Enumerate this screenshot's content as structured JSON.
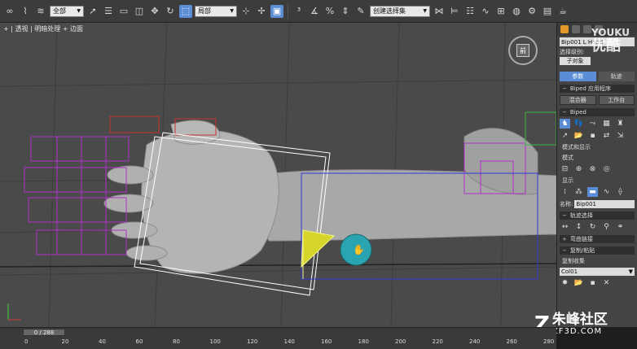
{
  "toolbar": {
    "selection_filter": "全部",
    "coord_system": "局部",
    "named_selection": "创建选择集",
    "icons": [
      "link-icon",
      "unlink-icon",
      "bind-icon",
      "select-icon",
      "select-by-name-icon",
      "rect-select-icon",
      "window-crossing-icon",
      "move-icon",
      "rotate-icon",
      "scale-icon",
      "pivot-icon",
      "snap-icon",
      "angle-snap-icon",
      "percent-snap-icon",
      "spinner-snap-icon",
      "mirror-icon",
      "align-icon",
      "layer-icon",
      "curve-editor-icon",
      "schematic-icon",
      "material-icon",
      "render-setup-icon",
      "render-frame-icon",
      "render-icon",
      "teapot-icon"
    ]
  },
  "viewport": {
    "label": "+ | 透视 | 明暗处理 + 边面"
  },
  "nav_cube_label": "前",
  "panel": {
    "object_name": "Bip001 L Hand",
    "selection_level_label": "选择级别:",
    "sub_object_button": "子对象",
    "motion_tabs": [
      "参数",
      "轨迹"
    ],
    "rollout_biped_apps": "Biped 应用程序",
    "btn_mixer": "混合器",
    "btn_workbench": "工作台",
    "rollout_biped": "Biped",
    "label_mode_display": "模式和显示",
    "label_mode": "模式",
    "label_display": "显示",
    "name_label": "名称:",
    "name_value": "Bip001",
    "rollout_track_select": "轨迹选择",
    "rollout_bend_links": "弯曲链接",
    "rollout_copy_paste": "复制/粘贴",
    "label_copy_collection": "复制收集",
    "collection_value": "Col01"
  },
  "watermarks": {
    "youku_line1": "YOUKU",
    "youku_line2": "优酷",
    "zf_text": "朱峰社区",
    "zf_url": "ZF3D.COM"
  },
  "timeline": {
    "time_slider_text": "0 / 288",
    "ruler_labels": [
      "0",
      "20",
      "40",
      "60",
      "80",
      "100",
      "120",
      "140",
      "160",
      "180",
      "200",
      "220",
      "240",
      "260",
      "280"
    ]
  }
}
